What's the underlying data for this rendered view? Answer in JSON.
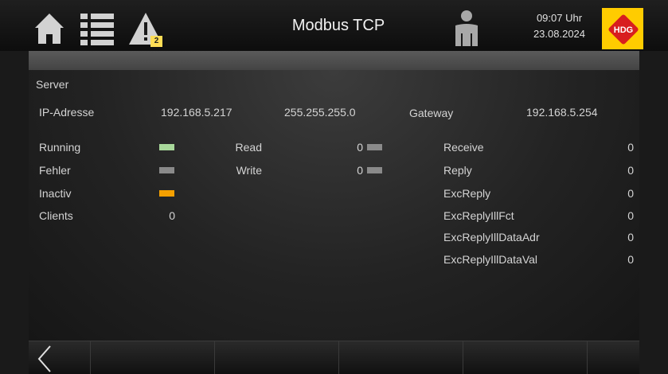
{
  "header": {
    "title": "Modbus TCP",
    "time": "09:07 Uhr",
    "date": "23.08.2024",
    "warning_count": "2",
    "logo_text": "HDG",
    "icons": [
      "home-icon",
      "list-icon",
      "warning-icon",
      "user-icon"
    ]
  },
  "server": {
    "section_title": "Server",
    "ip_label": "IP-Adresse",
    "ip_address": "192.168.5.217",
    "subnet_mask": "255.255.255.0",
    "gateway_label": "Gateway",
    "gateway": "192.168.5.254"
  },
  "status": [
    {
      "label": "Running",
      "color": "#a8d89a"
    },
    {
      "label": "Fehler",
      "color": "#8a8a8a"
    },
    {
      "label": "Inactiv",
      "color": "#f5a000"
    }
  ],
  "clients": {
    "label": "Clients",
    "value": "0"
  },
  "io": [
    {
      "label": "Read",
      "value": "0",
      "color": "#8a8a8a"
    },
    {
      "label": "Write",
      "value": "0",
      "color": "#8a8a8a"
    }
  ],
  "counters": [
    {
      "label": "Receive",
      "value": "0"
    },
    {
      "label": "Reply",
      "value": "0"
    },
    {
      "label": "ExcReply",
      "value": "0"
    },
    {
      "label": "ExcReplyIllFct",
      "value": "0"
    },
    {
      "label": "ExcReplyIllDataAdr",
      "value": "0"
    },
    {
      "label": "ExcReplyIllDataVal",
      "value": "0"
    }
  ],
  "footer": {
    "back_icon": "chevron-left-icon"
  }
}
